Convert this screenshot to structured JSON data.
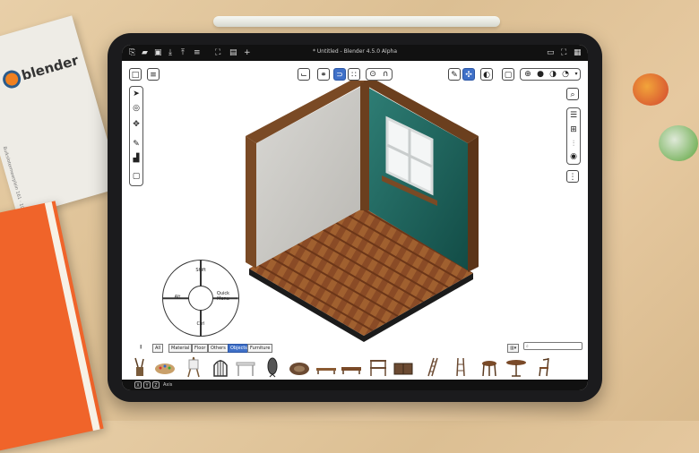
{
  "window": {
    "title": "* Untitled - Blender 4.5.0 Alpha"
  },
  "card": {
    "brand": "blender",
    "address": "Buikslotermeerplein 161 · 1025 ET Amsterdam · NL"
  },
  "pie_menu": {
    "top": "Shift",
    "left": "Alt",
    "right": "Quick Menu",
    "bottom": "Ctrl"
  },
  "asset_tabs": [
    "All",
    "Material",
    "Floor",
    "Others",
    "Objects",
    "Furniture"
  ],
  "asset_tabs_active": "Objects",
  "asset_search": {
    "placeholder": ""
  },
  "asset_items": [
    "brush-cup",
    "palette",
    "easel",
    "birdcage",
    "side-table",
    "mirror",
    "round-rug",
    "bench",
    "bench-2",
    "shelf",
    "cabinet",
    "ladder",
    "ladder-2",
    "stool",
    "round-table",
    "chair"
  ],
  "status": {
    "keys": [
      "X",
      "Y",
      "Z"
    ],
    "label": "Axis"
  },
  "colors": {
    "accent": "#3f70c8",
    "wall_teal": "#1f6b63",
    "wood": "#7a4a25",
    "floor": "#8a4b26"
  }
}
